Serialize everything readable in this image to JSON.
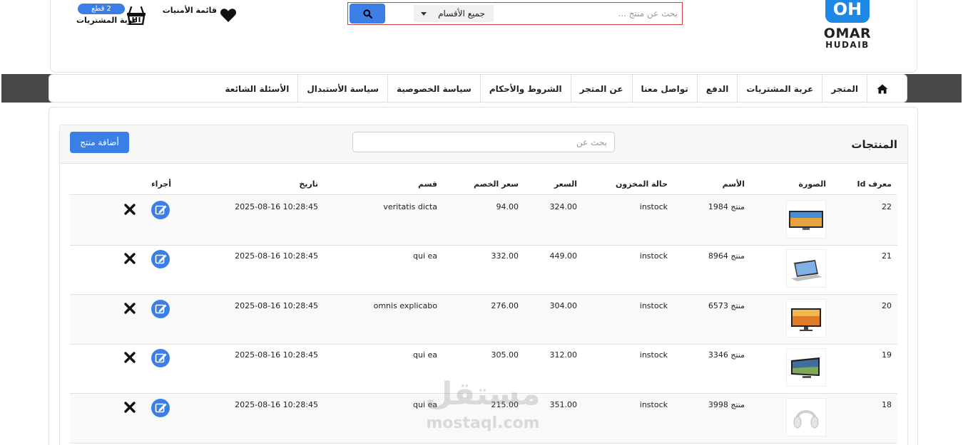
{
  "brand": {
    "mark": "OH",
    "line1": "OMAR",
    "line2": "HUDAIB"
  },
  "search": {
    "placeholder": "بحث عن منتج ...",
    "category": "جميع الأقسام"
  },
  "wishlist": {
    "label": "قائمة الأمنيات"
  },
  "cart": {
    "badge": "2 قطع",
    "label": "عربة المشتريات"
  },
  "nav": {
    "items": [
      {
        "label": "المتجر"
      },
      {
        "label": "عربة المشتريات"
      },
      {
        "label": "الدفع"
      },
      {
        "label": "تواصل معنا"
      },
      {
        "label": "عن المتجر"
      },
      {
        "label": "الشروط والأحكام"
      },
      {
        "label": "سياسة الخصوصية"
      },
      {
        "label": "سياسة الأستبدال"
      },
      {
        "label": "الأسئلة الشائعة"
      }
    ]
  },
  "products": {
    "title": "المنتجات",
    "search_placeholder": "بحث عن",
    "add_label": "أضافة منتج",
    "columns": {
      "id": "معرف Id",
      "image": "الصورة",
      "name": "الأسم",
      "stock": "حالة المخزون",
      "price": "السعر",
      "discount": "سعر الخصم",
      "category": "قسم",
      "date": "تاريخ",
      "actions": "أجراء"
    },
    "rows": [
      {
        "id": "22",
        "image": "tv-icon",
        "name": "منتج 1984",
        "stock": "instock",
        "price": "324.00",
        "discount": "94.00",
        "category": "veritatis dicta",
        "date": "2025-08-16 10:28:45"
      },
      {
        "id": "21",
        "image": "laptop-icon",
        "name": "منتج 8964",
        "stock": "instock",
        "price": "449.00",
        "discount": "332.00",
        "category": "qui ea",
        "date": "2025-08-16 10:28:45"
      },
      {
        "id": "20",
        "image": "monitor-icon",
        "name": "منتج 6573",
        "stock": "instock",
        "price": "304.00",
        "discount": "276.00",
        "category": "omnis explicabo",
        "date": "2025-08-16 10:28:45"
      },
      {
        "id": "19",
        "image": "tv-icon",
        "name": "منتج 3346",
        "stock": "instock",
        "price": "312.00",
        "discount": "305.00",
        "category": "qui ea",
        "date": "2025-08-16 10:28:45"
      },
      {
        "id": "18",
        "image": "headphones-icon",
        "name": "منتج 3998",
        "stock": "instock",
        "price": "351.00",
        "discount": "215.00",
        "category": "qui ea",
        "date": "2025-08-16 10:28:45"
      }
    ]
  },
  "watermark": {
    "ar": "مستقل",
    "en": "mostaql.com"
  },
  "colors": {
    "accent": "#3b7fe6",
    "nav_band": "#484848",
    "search_border": "#d23f3f"
  }
}
